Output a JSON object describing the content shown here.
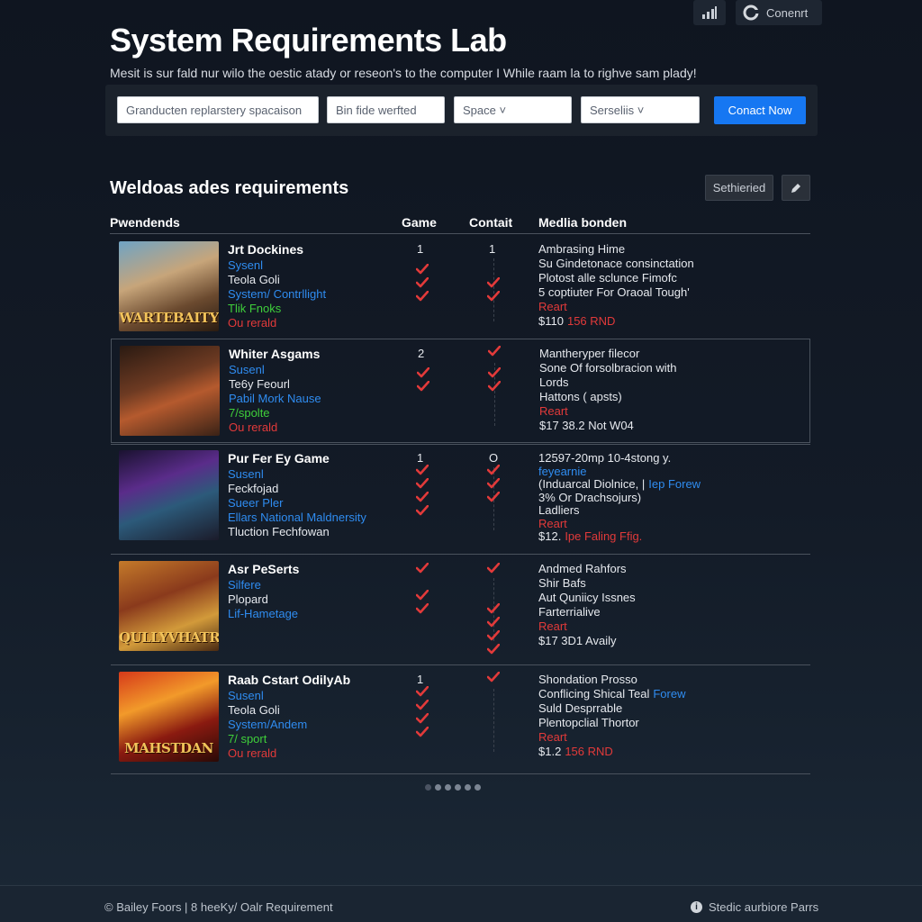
{
  "topbar": {
    "connect_label": "Conenrt"
  },
  "header": {
    "title": "System Requirements Lab",
    "subtitle": "Mesit is sur fald nur wilo the oestic atady or reseon's to the computer I While raam la to righve sam plady!"
  },
  "filters": {
    "field1": "Granducten replarstery spacaison",
    "field2": "Bin fide werfted",
    "field3": "Space",
    "field4": "Serseliis",
    "cta_label": "Conact Now"
  },
  "section": {
    "title": "Weldoas ades requirements",
    "settings_label": "Sethieried"
  },
  "table": {
    "headers": {
      "col1": "Pwendends",
      "col2": "Game",
      "col3": "Contait",
      "col4": "Medlia bonden"
    }
  },
  "games": [
    {
      "title": "Jrt Dockines",
      "logo": "WARTEBAITY",
      "lines": [
        {
          "text": "Sysenl",
          "color": "blue"
        },
        {
          "text": "Teola Goli",
          "color": "white"
        },
        {
          "text": "System/ Contrllight",
          "color": "blue"
        },
        {
          "text": "Tlik Fnoks",
          "color": "green"
        },
        {
          "text": "Ou rerald",
          "color": "red"
        }
      ],
      "game_num": "1",
      "contait_num": "1",
      "media": [
        {
          "text": "Ambrasing Hime",
          "color": "white"
        },
        {
          "text": "Su Gindetonace consinctation",
          "color": "white"
        },
        {
          "text": "Plotost alle sclunce Fimofc",
          "color": "white"
        },
        {
          "text": "5 coptiuter For Oraoal Tough'",
          "color": "white"
        },
        {
          "text": "Reart",
          "color": "red"
        },
        {
          "text": "$110",
          "color": "white",
          "extra": "156 RND",
          "extra_color": "red"
        }
      ]
    },
    {
      "title": "Whiter Asgams",
      "logo": "",
      "lines": [
        {
          "text": "Susenl",
          "color": "blue"
        },
        {
          "text": "Te6y Feourl",
          "color": "white"
        },
        {
          "text": "Pabil Mork Nause",
          "color": "blue"
        },
        {
          "text": "7/spolte",
          "color": "green"
        },
        {
          "text": "Ou rerald",
          "color": "red"
        }
      ],
      "game_num": "2",
      "contait_num": "",
      "media": [
        {
          "text": "Mantheryper filecor",
          "color": "white"
        },
        {
          "text": "Sone Of forsolbracion with",
          "color": "white"
        },
        {
          "text": "Lords",
          "color": "white"
        },
        {
          "text": "Hattons ( apsts)",
          "color": "white"
        },
        {
          "text": "Reart",
          "color": "red"
        },
        {
          "text": "$17 38.2 Not W04",
          "color": "white"
        }
      ]
    },
    {
      "title": "Pur Fer Ey Game",
      "logo": "",
      "lines": [
        {
          "text": "Susenl",
          "color": "blue"
        },
        {
          "text": "Feckfojad",
          "color": "white"
        },
        {
          "text": "Sueer Pler",
          "color": "blue"
        },
        {
          "text": "Ellars National Maldnersity",
          "color": "blue"
        },
        {
          "text": "Tluction Fechfowan",
          "color": "white"
        }
      ],
      "game_num": "1",
      "contait_num": "O",
      "media": [
        {
          "text": "12597-20mp 10-4stong y.",
          "color": "white"
        },
        {
          "text": "feyearnie",
          "color": "blue"
        },
        {
          "text": "(Induarcal Diolnice, |",
          "color": "white",
          "extra": "Iep Forew",
          "extra_color": "blue"
        },
        {
          "text": "3% Or Drachsojurs)",
          "color": "white"
        },
        {
          "text": "Ladliers",
          "color": "white"
        },
        {
          "text": "Reart",
          "color": "red"
        },
        {
          "text": "$12.",
          "color": "white",
          "extra": "Ipe Faling Ffig.",
          "extra_color": "red"
        }
      ]
    },
    {
      "title": "Asr PeSerts",
      "logo": "QULLYVHATRIRS",
      "lines": [
        {
          "text": "Silfere",
          "color": "blue"
        },
        {
          "text": "Plopard",
          "color": "white"
        },
        {
          "text": "Lif-Hametage",
          "color": "blue"
        }
      ],
      "game_num": "",
      "contait_num": "",
      "media": [
        {
          "text": "Andmed Rahfors",
          "color": "white"
        },
        {
          "text": "Shir Bafs",
          "color": "white"
        },
        {
          "text": "Aut Quniicy Issnes",
          "color": "white"
        },
        {
          "text": "Farterrialive",
          "color": "white"
        },
        {
          "text": "Reart",
          "color": "red"
        },
        {
          "text": "$17 3D1 Availy",
          "color": "white"
        }
      ]
    },
    {
      "title": "Raab Cstart OdilyAb",
      "logo": "MAHSTDAN",
      "lines": [
        {
          "text": "Susenl",
          "color": "blue"
        },
        {
          "text": "Teola Goli",
          "color": "white"
        },
        {
          "text": "System/Andem",
          "color": "blue"
        },
        {
          "text": "7/ sport",
          "color": "green"
        },
        {
          "text": "Ou rerald",
          "color": "red"
        }
      ],
      "game_num": "1",
      "contait_num": "",
      "media": [
        {
          "text": "Shondation Prosso",
          "color": "white"
        },
        {
          "text": "Conflicing Shical Teal",
          "color": "white",
          "extra": "Forew",
          "extra_color": "blue"
        },
        {
          "text": "Suld Desprrable",
          "color": "white"
        },
        {
          "text": "Plentopclial Thortor",
          "color": "white"
        },
        {
          "text": "Reart",
          "color": "red"
        },
        {
          "text": "$1.2",
          "color": "white",
          "extra": "156 RND",
          "extra_color": "red"
        }
      ]
    }
  ],
  "footer": {
    "left": "© Bailey Foors | 8 heeKy/ Oalr Requirement",
    "right": "Stedic aurbiore Parrs"
  }
}
